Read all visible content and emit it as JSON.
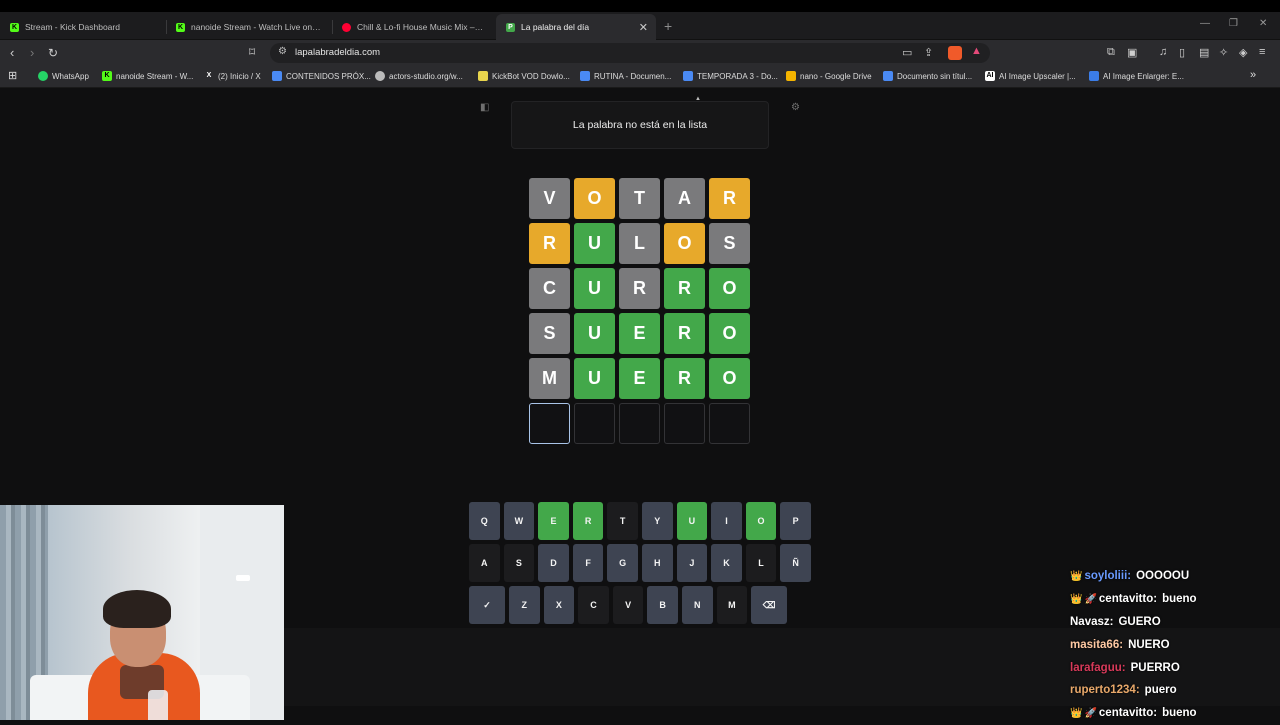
{
  "browser": {
    "tabs": [
      {
        "label": "Stream - Kick Dashboard",
        "favicon": "kick-icon",
        "color": "#53fc18"
      },
      {
        "label": "nanoide Stream - Watch Live on Kick",
        "favicon": "kick-icon",
        "color": "#53fc18"
      },
      {
        "label": "Chill & Lo-fi House Music Mix – Cozy",
        "favicon": "youtube-icon",
        "color": "#ff0033"
      },
      {
        "label": "La palabra del día",
        "favicon": "palabra-icon",
        "color": "#43a84a",
        "active": true
      }
    ],
    "url": "lapalabradeldia.com",
    "bookmarks": [
      {
        "label": "WhatsApp",
        "icon": "whatsapp-icon",
        "color": "#25d366"
      },
      {
        "label": "nanoide Stream - W...",
        "icon": "kick-icon",
        "color": "#53fc18"
      },
      {
        "label": "(2) Inicio / X",
        "icon": "x-icon",
        "color": "#ffffff"
      },
      {
        "label": "CONTENIDOS PRÓX...",
        "icon": "docs-icon",
        "color": "#4a8af4"
      },
      {
        "label": "actors-studio.org/w...",
        "icon": "globe-icon",
        "color": "#bbbbbb"
      },
      {
        "label": "KickBot VOD Dowlo...",
        "icon": "kickbot-icon",
        "color": "#e8d44d"
      },
      {
        "label": "RUTINA - Documen...",
        "icon": "docs-icon",
        "color": "#4a8af4"
      },
      {
        "label": "TEMPORADA 3 - Do...",
        "icon": "docs-icon",
        "color": "#4a8af4"
      },
      {
        "label": "nano - Google Drive",
        "icon": "drive-icon",
        "color": "#f4b400"
      },
      {
        "label": "Documento sin títul...",
        "icon": "docs-icon",
        "color": "#4a8af4"
      },
      {
        "label": "AI Image Upscaler |...",
        "icon": "ai-icon",
        "color": "#ffffff"
      },
      {
        "label": "AI Image Enlarger: E...",
        "icon": "enlarger-icon",
        "color": "#3b7de8"
      }
    ]
  },
  "game": {
    "toast": "La palabra no está en la lista",
    "board": [
      [
        {
          "l": "V",
          "s": "absent"
        },
        {
          "l": "O",
          "s": "present"
        },
        {
          "l": "T",
          "s": "absent"
        },
        {
          "l": "A",
          "s": "absent"
        },
        {
          "l": "R",
          "s": "present"
        }
      ],
      [
        {
          "l": "R",
          "s": "present"
        },
        {
          "l": "U",
          "s": "correct"
        },
        {
          "l": "L",
          "s": "absent"
        },
        {
          "l": "O",
          "s": "present"
        },
        {
          "l": "S",
          "s": "absent"
        }
      ],
      [
        {
          "l": "C",
          "s": "absent"
        },
        {
          "l": "U",
          "s": "correct"
        },
        {
          "l": "R",
          "s": "absent"
        },
        {
          "l": "R",
          "s": "correct"
        },
        {
          "l": "O",
          "s": "correct"
        }
      ],
      [
        {
          "l": "S",
          "s": "absent"
        },
        {
          "l": "U",
          "s": "correct"
        },
        {
          "l": "E",
          "s": "correct"
        },
        {
          "l": "R",
          "s": "correct"
        },
        {
          "l": "O",
          "s": "correct"
        }
      ],
      [
        {
          "l": "M",
          "s": "absent"
        },
        {
          "l": "U",
          "s": "correct"
        },
        {
          "l": "E",
          "s": "correct"
        },
        {
          "l": "R",
          "s": "correct"
        },
        {
          "l": "O",
          "s": "correct"
        }
      ],
      [
        {
          "l": "",
          "s": "empty"
        },
        {
          "l": "",
          "s": "empty"
        },
        {
          "l": "",
          "s": "empty"
        },
        {
          "l": "",
          "s": "empty"
        },
        {
          "l": "",
          "s": "empty"
        }
      ]
    ],
    "keyboard": [
      [
        {
          "k": "Q",
          "s": "unused"
        },
        {
          "k": "W",
          "s": "unused"
        },
        {
          "k": "E",
          "s": "correct"
        },
        {
          "k": "R",
          "s": "correct"
        },
        {
          "k": "T",
          "s": "absent"
        },
        {
          "k": "Y",
          "s": "unused"
        },
        {
          "k": "U",
          "s": "correct"
        },
        {
          "k": "I",
          "s": "unused"
        },
        {
          "k": "O",
          "s": "correct"
        },
        {
          "k": "P",
          "s": "unused"
        }
      ],
      [
        {
          "k": "A",
          "s": "absent"
        },
        {
          "k": "S",
          "s": "absent"
        },
        {
          "k": "D",
          "s": "unused"
        },
        {
          "k": "F",
          "s": "unused"
        },
        {
          "k": "G",
          "s": "unused"
        },
        {
          "k": "H",
          "s": "unused"
        },
        {
          "k": "J",
          "s": "unused"
        },
        {
          "k": "K",
          "s": "unused"
        },
        {
          "k": "L",
          "s": "absent"
        },
        {
          "k": "Ñ",
          "s": "unused"
        }
      ],
      [
        {
          "k": "✓",
          "s": "unused",
          "name": "enter-key"
        },
        {
          "k": "Z",
          "s": "unused"
        },
        {
          "k": "X",
          "s": "unused"
        },
        {
          "k": "C",
          "s": "absent"
        },
        {
          "k": "V",
          "s": "absent"
        },
        {
          "k": "B",
          "s": "unused"
        },
        {
          "k": "N",
          "s": "unused"
        },
        {
          "k": "M",
          "s": "absent"
        },
        {
          "k": "⌫",
          "s": "unused",
          "name": "backspace-key"
        }
      ]
    ]
  },
  "chat": [
    {
      "user": "soyloliii",
      "text": "OOOOOU",
      "color": "#6a9bff",
      "badges": [
        "crown-icon"
      ]
    },
    {
      "user": "centavitto",
      "text": "bueno",
      "color": "#ffffff",
      "badges": [
        "crown-icon",
        "rocket-icon"
      ]
    },
    {
      "user": "Navasz",
      "text": "GUERO",
      "color": "#ffffff",
      "badges": []
    },
    {
      "user": "masita66",
      "text": "NUERO",
      "color": "#ffc9a3",
      "badges": []
    },
    {
      "user": "larafaguu",
      "text": "PUERRO",
      "color": "#d83a5a",
      "badges": []
    },
    {
      "user": "ruperto1234",
      "text": "puero",
      "color": "#e8a86a",
      "badges": []
    },
    {
      "user": "centavitto",
      "text": "bueno",
      "color": "#ffffff",
      "badges": [
        "crown-icon",
        "rocket-icon"
      ]
    }
  ],
  "colors": {
    "correct": "#43a84a",
    "present": "#e7a92b",
    "absent": "#7a7a7c",
    "key_unused": "#3e4452",
    "key_absent": "#1c1c1e"
  }
}
